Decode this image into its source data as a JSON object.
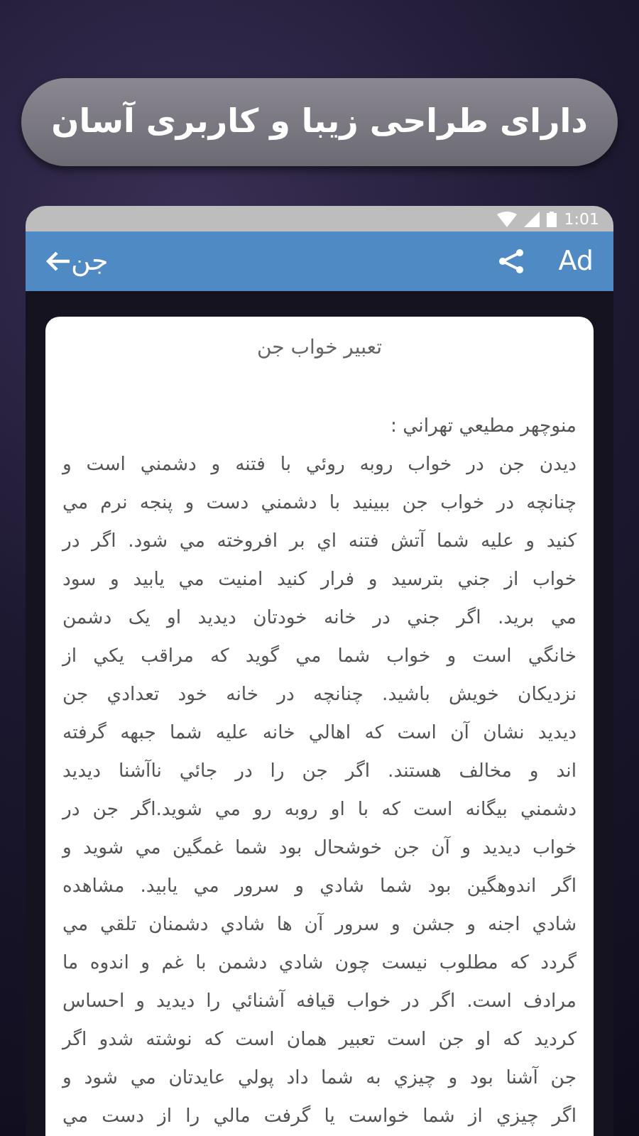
{
  "banner": {
    "title": "دارای طراحی زیبا و کاربری آسان"
  },
  "status_bar": {
    "time": "1:01"
  },
  "app_bar": {
    "ad_label": "Ad",
    "title": "جن"
  },
  "article": {
    "heading": "تعبير خواب جن",
    "lines": [
      "منوچهر مطيعي تهراني :",
      "ديدن جن در خواب روبه روئي با فتنه و دشمني است و",
      "چنانچه در خواب جن ببينيد با دشمني دست و پنجه نرم مي",
      "كنيد و عليه شما آتش فتنه اي بر افروخته مي شود. اگر در",
      "خواب از جني بترسيد و فرار كنيد امنيت مي يابيد و سود",
      "مي بريد. اگر جني در خانه خودتان ديديد او يک دشمن",
      "خانگي است و خواب شما مي گويد كه مراقب يكي از",
      "نزديكان خويش باشيد. چنانچه در خانه خود تعدادي جن",
      "ديديد نشان آن است كه اهالي خانه عليه شما جبهه گرفته",
      "اند و مخالف هستند. اگر جن را در جائي ناآشنا ديديد",
      "دشمني بيگانه است كه با او روبه رو مي شويد.اگر جن در",
      "خواب ديديد و آن جن خوشحال بود شما غمگين مي شويد و",
      "اگر اندوهگين بود شما شادي و سرور مي يابيد. مشاهده",
      "شادي اجنه و جشن و سرور آن ها شادي دشمنان تلقي مي",
      "گردد كه مطلوب نيست چون شادي دشمن با غم و اندوه ما",
      "مرادف است. اگر در خواب قيافه آشنائي را ديديد و احساس",
      "كرديد كه او جن است تعبير همان است كه نوشته شدو اگر",
      "جن آشنا بود و چيزي به شما داد پولي عايدتان مي شود و",
      "اگر چيزي از شما خواست يا گرفت مالي را از دست مي"
    ]
  }
}
